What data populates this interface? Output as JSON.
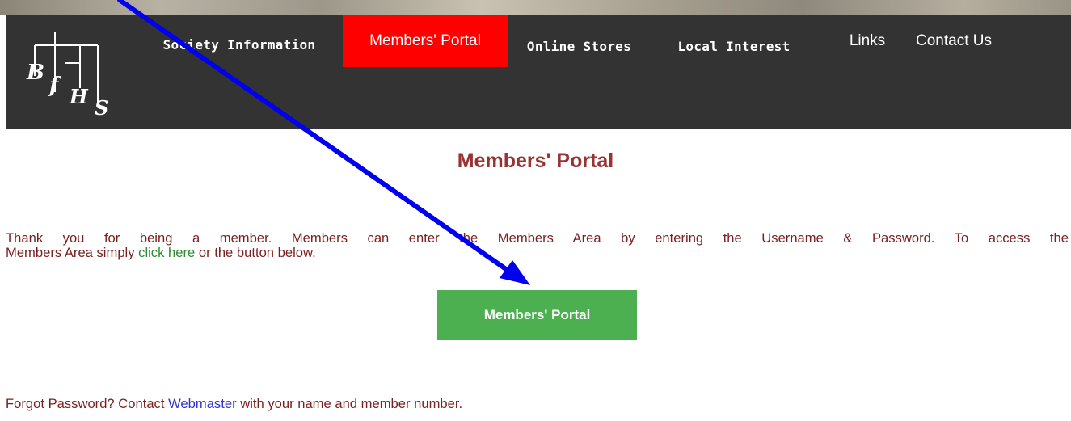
{
  "nav": {
    "logo_alt": "BFHS",
    "items": [
      {
        "label": "Society Information"
      },
      {
        "label": "Members' Portal",
        "active": true
      },
      {
        "label": "Online Stores"
      },
      {
        "label": "Local Interest"
      },
      {
        "label": "Links"
      },
      {
        "label": "Contact Us"
      }
    ]
  },
  "main": {
    "title": "Members' Portal",
    "intro_line1": "Thank you for being a member. Members can enter the Members Area by entering the Username & Password. To access the",
    "intro_line2_before": "Members Area simply ",
    "intro_link": "click here",
    "intro_line2_after": " or the button below.",
    "button_label": "Members' Portal",
    "forgot_before": "Forgot Password? Contact ",
    "forgot_link": "Webmaster",
    "forgot_after": " with your name and member number."
  },
  "colors": {
    "navbar_bg": "#333333",
    "active_nav_bg": "#ff0000",
    "title_color": "#993333",
    "body_text": "#7a1f1f",
    "button_bg": "#4caf50",
    "link_green": "#2e8b2e",
    "link_blue": "#3333cc",
    "annotation_arrow": "#0000ee"
  },
  "icons": {
    "logo": "bfhs-family-tree-logo",
    "annotation": "pointer-arrow"
  }
}
